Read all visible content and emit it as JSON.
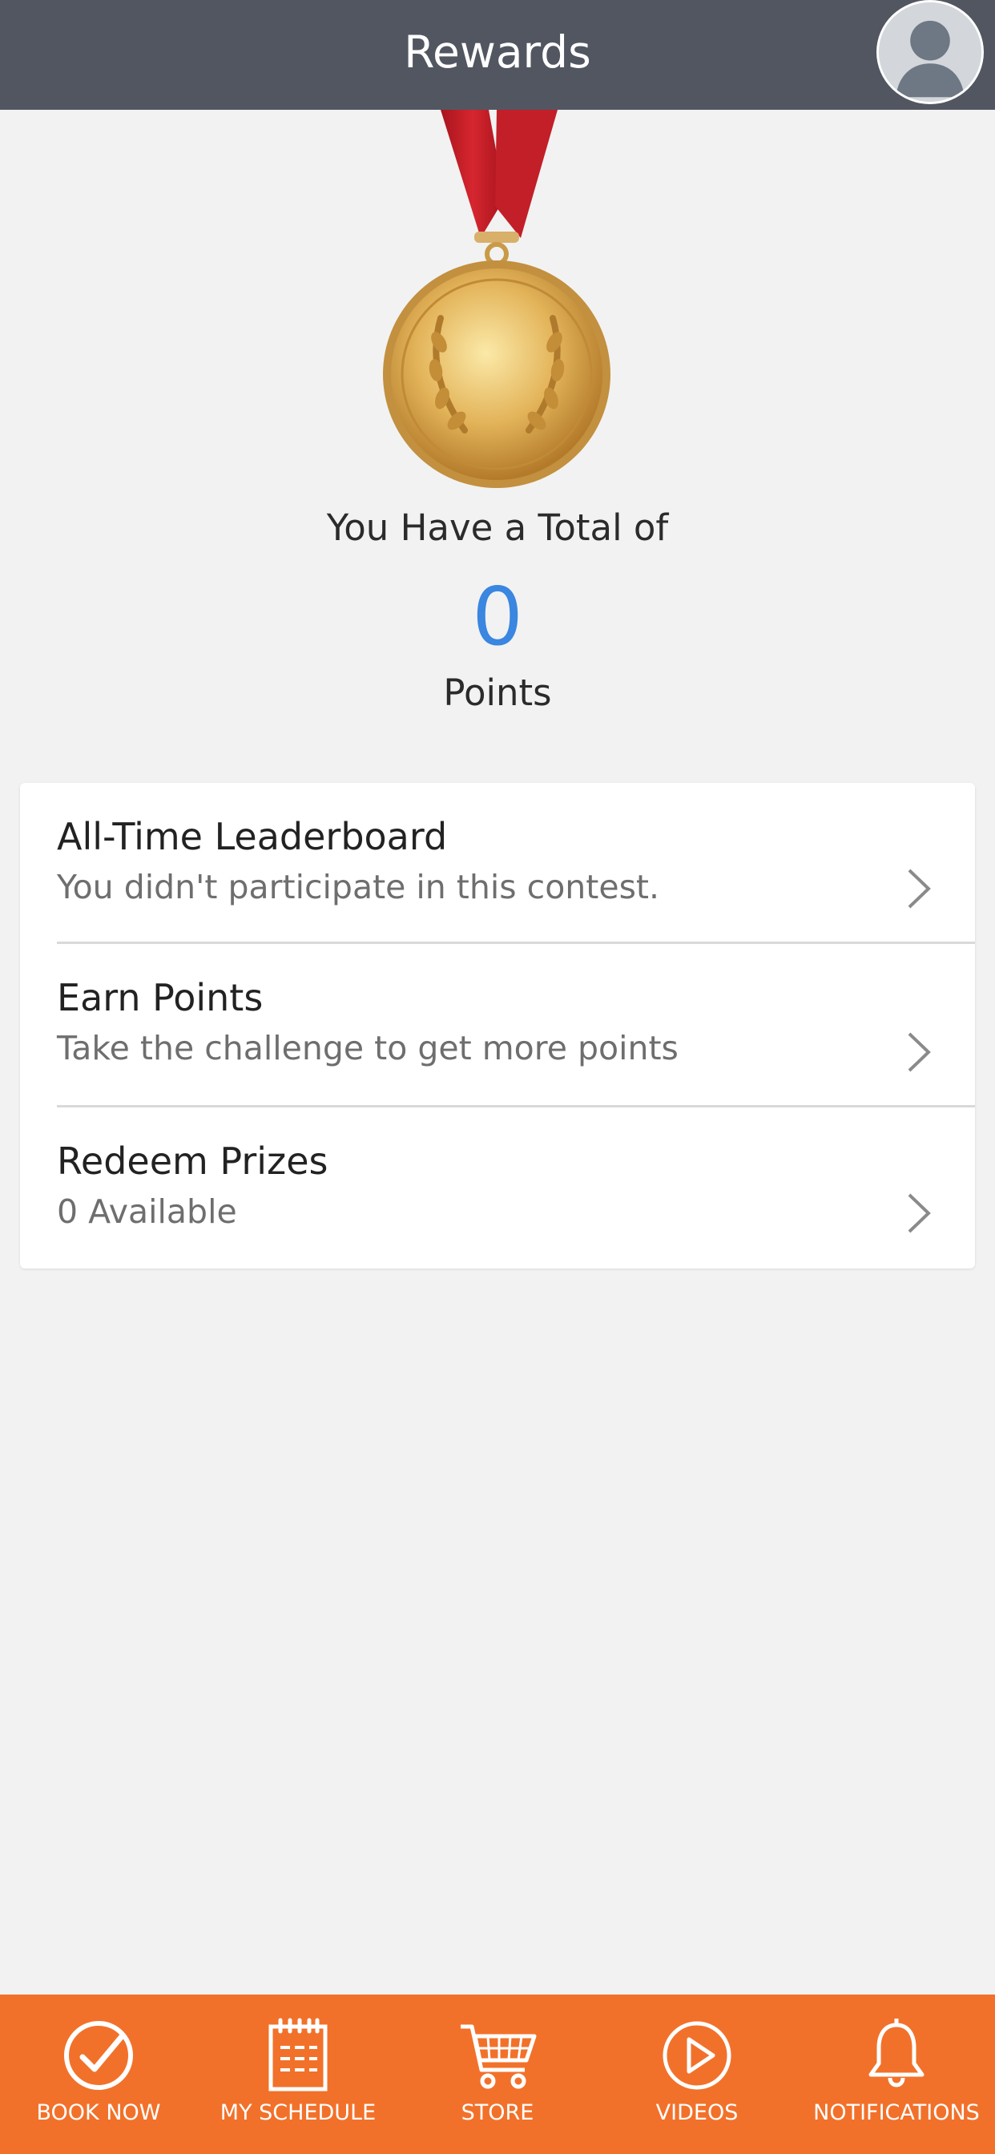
{
  "header": {
    "title": "Rewards"
  },
  "summary": {
    "total_label": "You Have a Total of",
    "points_value": "0",
    "points_unit": "Points"
  },
  "menu": {
    "items": [
      {
        "title": "All-Time Leaderboard",
        "subtitle": "You didn't participate in this contest."
      },
      {
        "title": "Earn Points",
        "subtitle": "Take the challenge to get more points"
      },
      {
        "title": "Redeem Prizes",
        "subtitle": "0 Available"
      }
    ]
  },
  "tabs": [
    {
      "label": "BOOK NOW",
      "icon": "check-circle-icon"
    },
    {
      "label": "MY SCHEDULE",
      "icon": "calendar-icon"
    },
    {
      "label": "STORE",
      "icon": "cart-icon"
    },
    {
      "label": "VIDEOS",
      "icon": "play-circle-icon"
    },
    {
      "label": "NOTIFICATIONS",
      "icon": "bell-icon"
    }
  ],
  "colors": {
    "header_bg": "#525661",
    "accent_blue": "#3a86e0",
    "tabbar_bg": "#f2712a",
    "ribbon_red": "#c8202a",
    "medal_gold": "#d9a54a"
  }
}
